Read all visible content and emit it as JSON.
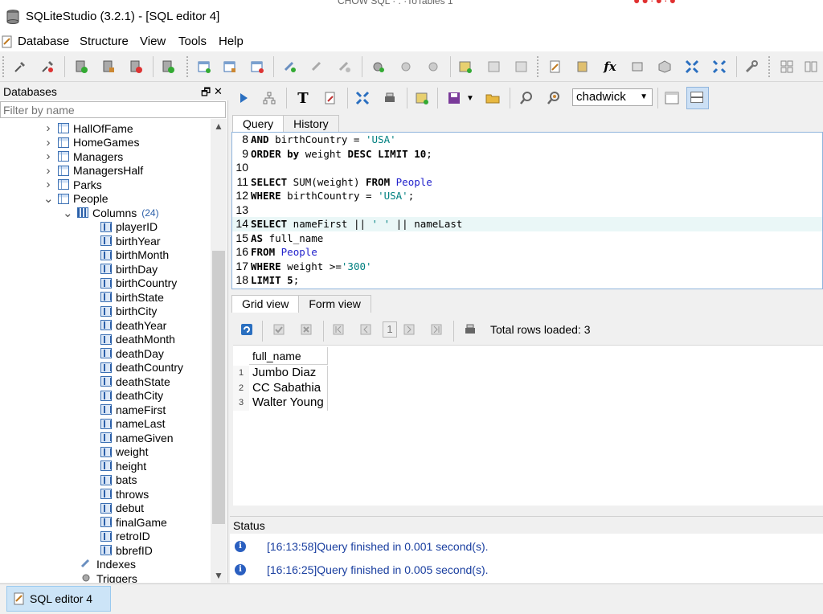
{
  "window": {
    "title": "SQLiteStudio (3.2.1) - [SQL editor 4]",
    "behind_text": "CHOW SQL ·  .  ·ToTables  1",
    "behind_marks": "●●·●·●"
  },
  "menu": [
    "Database",
    "Structure",
    "View",
    "Tools",
    "Help"
  ],
  "databases_panel": {
    "title": "Databases",
    "float_icon": "🗗",
    "close_icon": "✕",
    "filter_placeholder": "Filter by name",
    "tables": [
      {
        "name": "HallOfFame",
        "expanded": false
      },
      {
        "name": "HomeGames",
        "expanded": false
      },
      {
        "name": "Managers",
        "expanded": false
      },
      {
        "name": "ManagersHalf",
        "expanded": false
      },
      {
        "name": "Parks",
        "expanded": false
      },
      {
        "name": "People",
        "expanded": true
      }
    ],
    "columns_label": "Columns",
    "columns_count": "(24)",
    "columns": [
      "playerID",
      "birthYear",
      "birthMonth",
      "birthDay",
      "birthCountry",
      "birthState",
      "birthCity",
      "deathYear",
      "deathMonth",
      "deathDay",
      "deathCountry",
      "deathState",
      "deathCity",
      "nameFirst",
      "nameLast",
      "nameGiven",
      "weight",
      "height",
      "bats",
      "throws",
      "debut",
      "finalGame",
      "retroID",
      "bbrefID"
    ],
    "indexes_label": "Indexes",
    "triggers_label": "Triggers"
  },
  "editor": {
    "database": "chadwick",
    "tabs": [
      "Query",
      "History"
    ],
    "active_tab": "Query",
    "lines": [
      {
        "n": "8",
        "tokens": [
          {
            "t": "AND",
            "c": "kw"
          },
          {
            "t": " birthCountry = ",
            "c": ""
          },
          {
            "t": "'USA'",
            "c": "str"
          }
        ]
      },
      {
        "n": "9",
        "tokens": [
          {
            "t": "ORDER by",
            "c": "kw"
          },
          {
            "t": " weight ",
            "c": ""
          },
          {
            "t": "DESC LIMIT",
            "c": "kw"
          },
          {
            "t": " ",
            "c": ""
          },
          {
            "t": "10",
            "c": "kw"
          },
          {
            "t": ";",
            "c": ""
          }
        ]
      },
      {
        "n": "10",
        "tokens": []
      },
      {
        "n": "11",
        "tokens": [
          {
            "t": "SELECT",
            "c": "kw"
          },
          {
            "t": " SUM(weight) ",
            "c": ""
          },
          {
            "t": "FROM",
            "c": "kw"
          },
          {
            "t": " ",
            "c": ""
          },
          {
            "t": "People",
            "c": "obj"
          }
        ]
      },
      {
        "n": "12",
        "tokens": [
          {
            "t": "WHERE",
            "c": "kw"
          },
          {
            "t": " birthCountry = ",
            "c": ""
          },
          {
            "t": "'USA'",
            "c": "str"
          },
          {
            "t": ";",
            "c": ""
          }
        ]
      },
      {
        "n": "13",
        "tokens": []
      },
      {
        "n": "14",
        "tokens": [
          {
            "t": "SELECT",
            "c": "kw"
          },
          {
            "t": " nameFirst || ",
            "c": ""
          },
          {
            "t": "' '",
            "c": "str"
          },
          {
            "t": " || nameLast",
            "c": ""
          }
        ],
        "current": true
      },
      {
        "n": "15",
        "tokens": [
          {
            "t": "AS",
            "c": "kw"
          },
          {
            "t": " full_name",
            "c": ""
          }
        ]
      },
      {
        "n": "16",
        "tokens": [
          {
            "t": "FROM",
            "c": "kw"
          },
          {
            "t": " ",
            "c": ""
          },
          {
            "t": "People",
            "c": "obj"
          }
        ]
      },
      {
        "n": "17",
        "tokens": [
          {
            "t": "WHERE",
            "c": "kw"
          },
          {
            "t": " weight >=",
            "c": ""
          },
          {
            "t": "'300'",
            "c": "str"
          }
        ]
      },
      {
        "n": "18",
        "tokens": [
          {
            "t": "LIMIT",
            "c": "kw"
          },
          {
            "t": " ",
            "c": ""
          },
          {
            "t": "5",
            "c": "kw"
          },
          {
            "t": ";",
            "c": ""
          }
        ]
      }
    ]
  },
  "results": {
    "tabs": [
      "Grid view",
      "Form view"
    ],
    "active_tab": "Grid view",
    "page": "1",
    "total_rows": "Total rows loaded: 3",
    "column": "full_name",
    "rows": [
      {
        "num": "1",
        "value": "Jumbo Diaz"
      },
      {
        "num": "2",
        "value": "CC Sabathia"
      },
      {
        "num": "3",
        "value": "Walter Young"
      }
    ]
  },
  "status": {
    "title": "Status",
    "messages": [
      {
        "time": "[16:13:58]",
        "text": "Query finished in 0.001 second(s)."
      },
      {
        "time": "[16:16:25]",
        "text": "Query finished in 0.005 second(s)."
      }
    ]
  },
  "taskbar": {
    "window_label": "SQL editor 4"
  },
  "colors": {
    "accent": "#2b5fa8",
    "keyword": "#000000",
    "string": "#008080",
    "object": "#2222cc",
    "status_text": "#1a3fa0"
  }
}
